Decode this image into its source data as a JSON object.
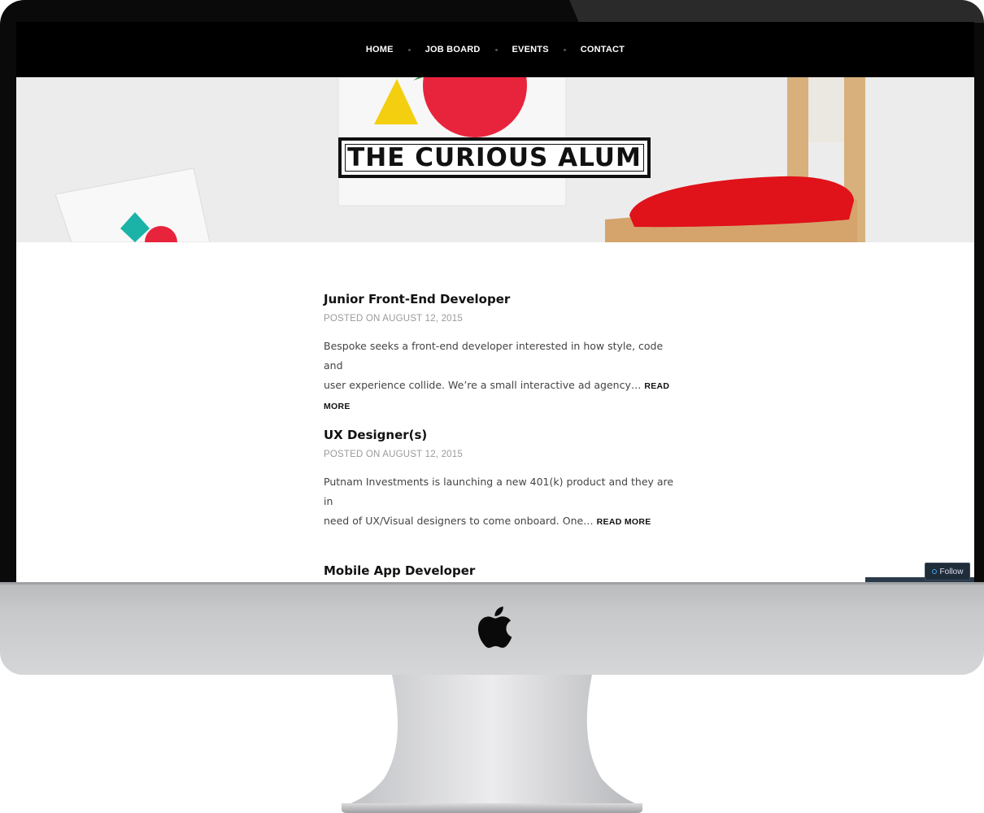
{
  "nav": {
    "items": [
      {
        "label": "HOME"
      },
      {
        "label": "JOB BOARD"
      },
      {
        "label": "EVENTS"
      },
      {
        "label": "CONTACT"
      }
    ]
  },
  "site": {
    "title": "THE CURIOUS ALUM"
  },
  "posts": [
    {
      "title": "Junior Front-End Developer",
      "meta": "POSTED ON AUGUST 12, 2015",
      "excerpt_line1": "Bespoke seeks a front-end developer interested in how style, code and",
      "excerpt_line2": "user experience collide. We’re a small interactive ad agency…",
      "read_more": "READ MORE"
    },
    {
      "title": "UX Designer(s)",
      "meta": "POSTED ON AUGUST 12, 2015",
      "excerpt_line1": "Putnam Investments is launching a new 401(k) product and they are in",
      "excerpt_line2": "need of UX/Visual designers to come onboard. One…",
      "read_more": "READ MORE"
    },
    {
      "title": "Mobile App Developer"
    }
  ],
  "follow": {
    "label": "Follow"
  },
  "icons": {
    "apple": "apple-logo-icon",
    "follow": "follow-circle-icon"
  },
  "colors": {
    "nav_bg": "#000000",
    "hero_red": "#e8243c",
    "hero_yellow": "#f3cf10",
    "hero_teal": "#1bb3a8",
    "chair_cushion": "#e0121a"
  }
}
